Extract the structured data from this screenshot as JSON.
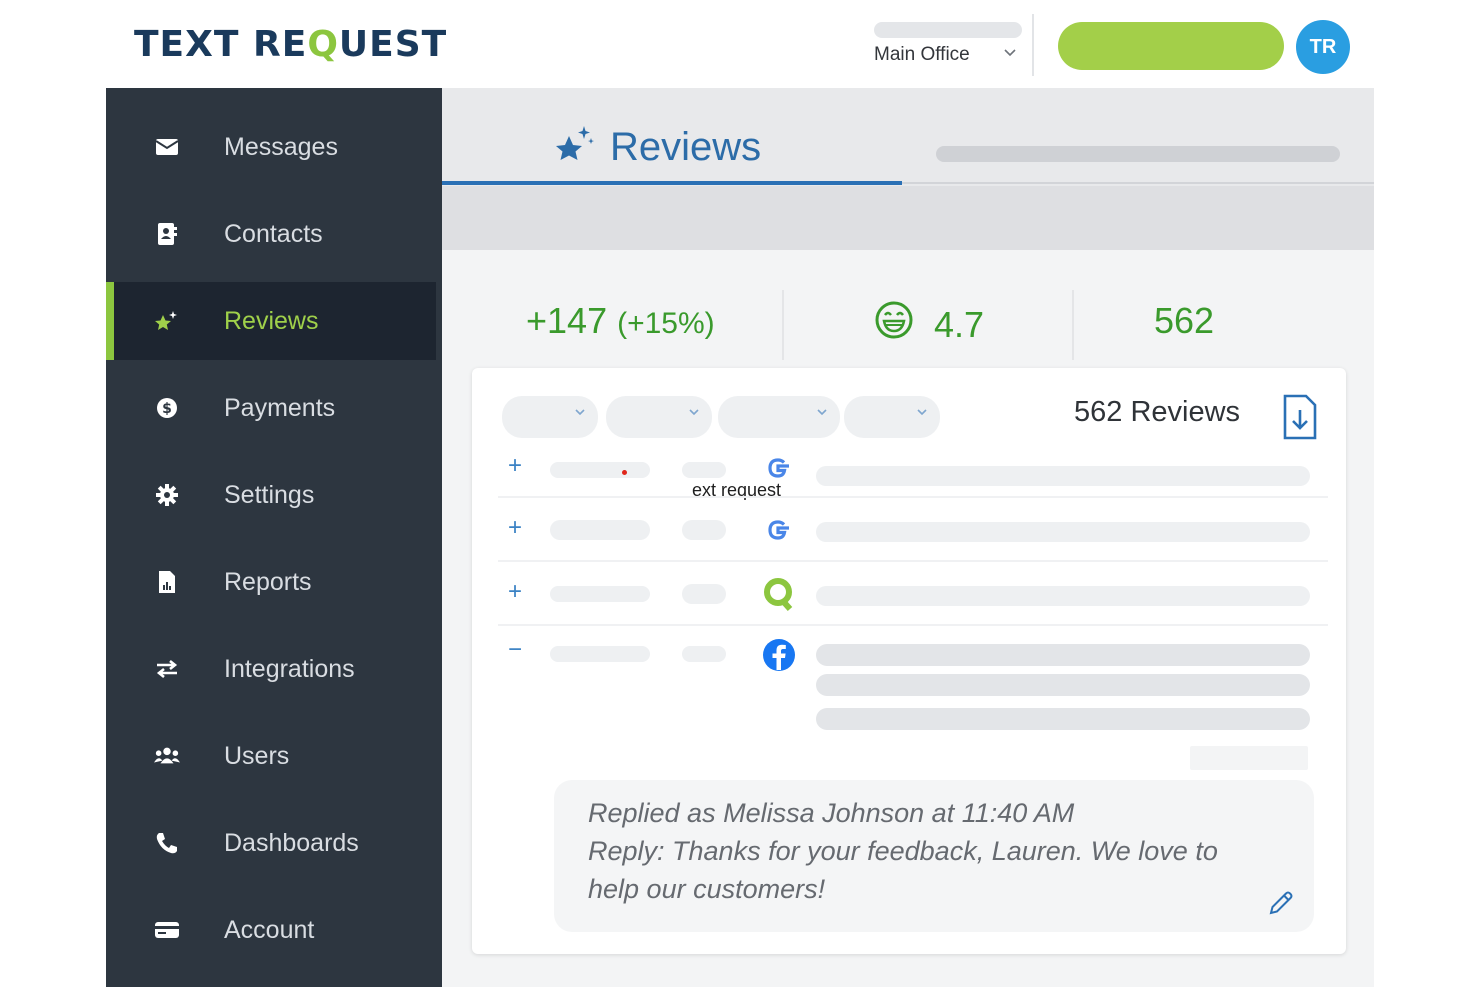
{
  "header": {
    "logo_part1": "TEXT RE",
    "logo_q": "Q",
    "logo_part2": "UEST",
    "location": "Main Office",
    "avatar_initials": "TR"
  },
  "sidebar": {
    "items": [
      {
        "label": "Messages",
        "icon": "envelope-icon"
      },
      {
        "label": "Contacts",
        "icon": "contact-card-icon"
      },
      {
        "label": "Reviews",
        "icon": "sparkle-star-icon",
        "active": true
      },
      {
        "label": "Payments",
        "icon": "dollar-coin-icon"
      },
      {
        "label": "Settings",
        "icon": "gear-icon"
      },
      {
        "label": "Reports",
        "icon": "report-file-icon"
      },
      {
        "label": "Integrations",
        "icon": "swap-arrows-icon"
      },
      {
        "label": "Users",
        "icon": "users-icon"
      },
      {
        "label": "Dashboards",
        "icon": "phone-icon"
      },
      {
        "label": "Account",
        "icon": "credit-card-icon"
      }
    ]
  },
  "main": {
    "tab_label": "Reviews",
    "stats": {
      "growth": "+147",
      "growth_pct": "(+15%)",
      "rating": "4.7",
      "total": "562"
    },
    "card": {
      "count_label": "562 Reviews",
      "overlay_text": "ext request",
      "rows": [
        {
          "toggle": "+",
          "source": "google-icon"
        },
        {
          "toggle": "+",
          "source": "google-icon"
        },
        {
          "toggle": "+",
          "source": "green-q-icon"
        },
        {
          "toggle": "−",
          "source": "facebook-icon"
        }
      ],
      "reply": {
        "line1": "Replied as Melissa Johnson at 11:40 AM",
        "line2": "Reply: Thanks for your feedback, Lauren. We love to",
        "line3": "help our customers!"
      }
    }
  },
  "colors": {
    "brand_navy": "#1a3a5c",
    "brand_green": "#8cc63f",
    "sidebar_bg": "#2d3640",
    "accent_blue": "#2a70b5",
    "stat_green": "#3a9a2c"
  }
}
